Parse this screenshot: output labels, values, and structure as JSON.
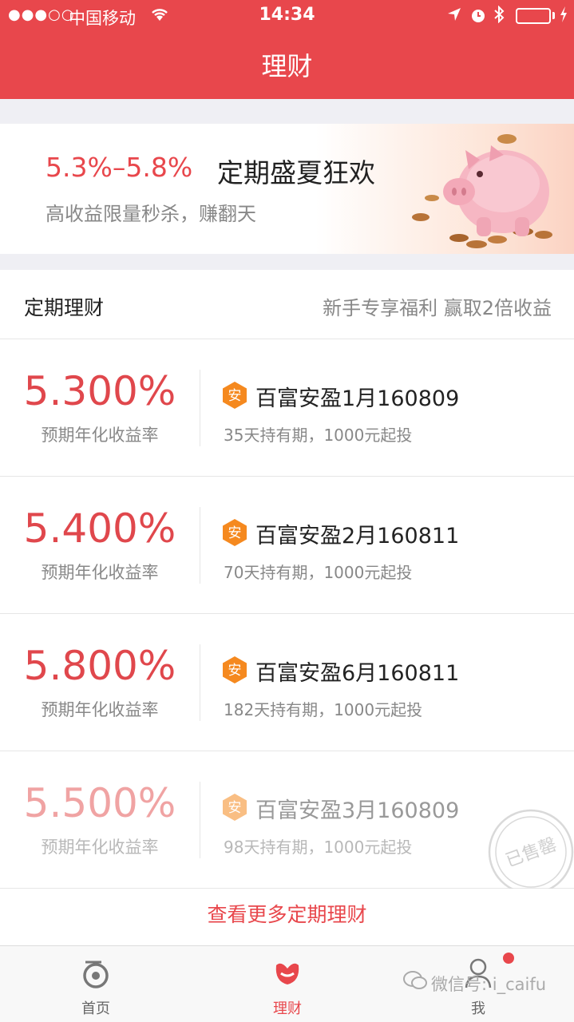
{
  "status_bar": {
    "signal": "●●●○○",
    "carrier": "中国移动",
    "time": "14:34"
  },
  "nav": {
    "title": "理财"
  },
  "banner": {
    "rate_range": "5.3%–5.8%",
    "title": "定期盛夏狂欢",
    "subtitle": "高收益限量秒杀，赚翻天"
  },
  "section": {
    "title": "定期理财",
    "promo": "新手专享福利 赢取2倍收益"
  },
  "products": [
    {
      "rate": "5.300%",
      "rate_label": "预期年化收益率",
      "badge": "安",
      "name": "百富安盈1月160809",
      "desc": "35天持有期，1000元起投"
    },
    {
      "rate": "5.400%",
      "rate_label": "预期年化收益率",
      "badge": "安",
      "name": "百富安盈2月160811",
      "desc": "70天持有期，1000元起投"
    },
    {
      "rate": "5.800%",
      "rate_label": "预期年化收益率",
      "badge": "安",
      "name": "百富安盈6月160811",
      "desc": "182天持有期，1000元起投"
    },
    {
      "rate": "5.500%",
      "rate_label": "预期年化收益率",
      "badge": "安",
      "name": "百富安盈3月160809",
      "desc": "98天持有期，1000元起投",
      "stamp": "已售罄"
    }
  ],
  "more_link": "查看更多定期理财",
  "tabs": [
    {
      "label": "首页",
      "icon": "home-icon"
    },
    {
      "label": "理财",
      "icon": "finance-icon"
    },
    {
      "label": "我",
      "icon": "user-icon"
    }
  ],
  "watermark": "微信号: i_caifu",
  "colors": {
    "brand": "#e8474c",
    "text_muted": "#888888"
  }
}
